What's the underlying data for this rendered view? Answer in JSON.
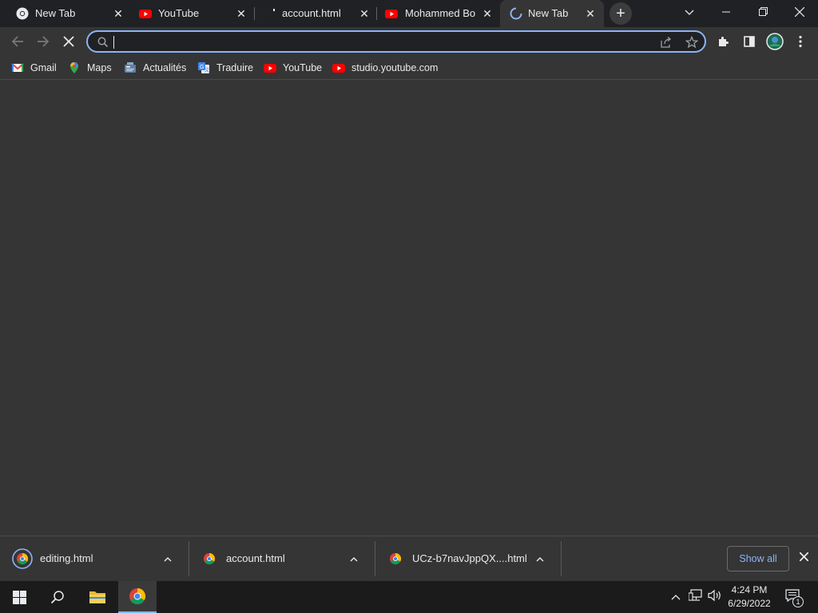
{
  "tabs": [
    {
      "title": "New Tab",
      "icon": "chrome-icon",
      "active": false
    },
    {
      "title": "YouTube",
      "icon": "youtube-icon",
      "active": false
    },
    {
      "title": "account.html",
      "icon": "loading-dot-icon",
      "active": false
    },
    {
      "title": "Mohammed Bou",
      "icon": "youtube-icon",
      "active": false
    },
    {
      "title": "New Tab",
      "icon": "loading-spinner-icon",
      "active": true
    }
  ],
  "omnibox": {
    "value": "",
    "placeholder": ""
  },
  "bookmarks": [
    {
      "label": "Gmail",
      "icon": "gmail-icon"
    },
    {
      "label": "Maps",
      "icon": "maps-icon"
    },
    {
      "label": "Actualités",
      "icon": "news-icon"
    },
    {
      "label": "Traduire",
      "icon": "translate-icon"
    },
    {
      "label": "YouTube",
      "icon": "youtube-icon"
    },
    {
      "label": "studio.youtube.com",
      "icon": "youtube-icon"
    }
  ],
  "downloads": {
    "items": [
      {
        "name": "editing.html"
      },
      {
        "name": "account.html"
      },
      {
        "name": "UCz-b7navJppQX....html"
      }
    ],
    "show_all_label": "Show all"
  },
  "taskbar": {
    "time": "4:24 PM",
    "date": "6/29/2022",
    "notification_count": "1"
  },
  "colors": {
    "accent": "#8ab4f8",
    "tabstrip_bg": "#202124",
    "page_bg": "#353535",
    "taskbar_bg": "#1b1b1b"
  }
}
